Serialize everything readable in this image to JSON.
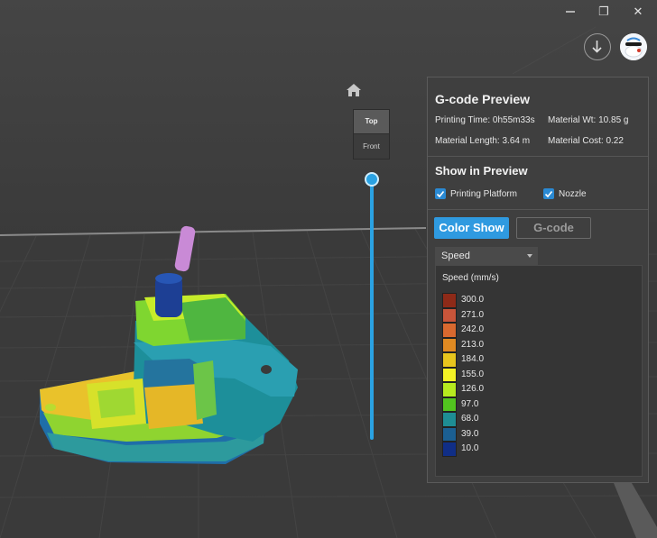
{
  "window": {
    "restore_glyph": "❐",
    "close_glyph": "✕"
  },
  "viewcube": {
    "top_label": "Top",
    "front_label": "Front"
  },
  "panel": {
    "title": "G-code Preview",
    "stats": {
      "printing_time": "Printing Time: 0h55m33s",
      "material_weight": "Material Wt: 10.85 g",
      "material_length": "Material Length: 3.64 m",
      "material_cost": "Material Cost: 0.22"
    },
    "show_in_preview": {
      "title": "Show in Preview",
      "printing_platform": {
        "label": "Printing Platform",
        "checked": true
      },
      "nozzle": {
        "label": "Nozzle",
        "checked": true
      }
    },
    "tabs": {
      "color_show": "Color Show",
      "gcode": "G-code",
      "active": "color_show"
    },
    "dropdown": {
      "selected": "Speed"
    },
    "legend": {
      "title": "Speed (mm/s)",
      "items": [
        {
          "value": "300.0",
          "color": "#8e2a18"
        },
        {
          "value": "271.0",
          "color": "#c8553a"
        },
        {
          "value": "242.0",
          "color": "#d9692f"
        },
        {
          "value": "213.0",
          "color": "#e08a22"
        },
        {
          "value": "184.0",
          "color": "#e8c51d"
        },
        {
          "value": "155.0",
          "color": "#f3f225"
        },
        {
          "value": "126.0",
          "color": "#b6ea1f"
        },
        {
          "value": "97.0",
          "color": "#52c41f"
        },
        {
          "value": "68.0",
          "color": "#1e8d94"
        },
        {
          "value": "39.0",
          "color": "#1b5f92"
        },
        {
          "value": "10.0",
          "color": "#102e86"
        }
      ]
    }
  },
  "colors": {
    "accent": "#2f9ae0",
    "panel_bg": "#3f3f3f",
    "viewport_bg": "#383838"
  },
  "icons": [
    "restore-icon",
    "close-icon",
    "download-icon",
    "avatar",
    "home-icon",
    "check-icon",
    "chevron-down-icon"
  ]
}
